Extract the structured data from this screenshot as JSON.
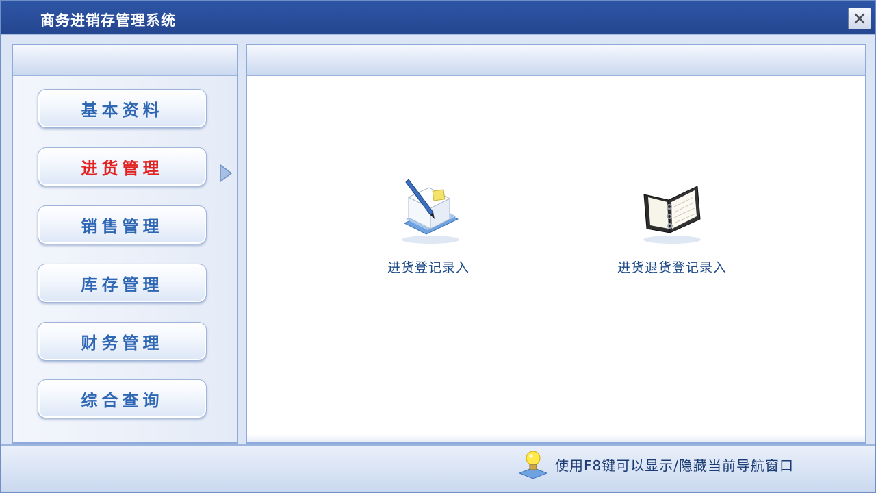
{
  "window": {
    "title": "商务进销存管理系统"
  },
  "sidebar": {
    "items": [
      {
        "label": "基本资料",
        "active": false
      },
      {
        "label": "进货管理",
        "active": true
      },
      {
        "label": "销售管理",
        "active": false
      },
      {
        "label": "库存管理",
        "active": false
      },
      {
        "label": "财务管理",
        "active": false
      },
      {
        "label": "综合查询",
        "active": false
      }
    ]
  },
  "main": {
    "functions": [
      {
        "label": "进货登记录入",
        "icon": "pen-document-icon"
      },
      {
        "label": "进货退货登记录入",
        "icon": "binder-icon"
      }
    ]
  },
  "status": {
    "tip": "使用F8键可以显示/隐藏当前导航窗口",
    "icon": "lightbulb-icon"
  },
  "colors": {
    "titlebar": "#2a4f9c",
    "active_nav": "#e02424",
    "nav_text": "#2f67b5",
    "panel_border": "#8eaadb"
  }
}
